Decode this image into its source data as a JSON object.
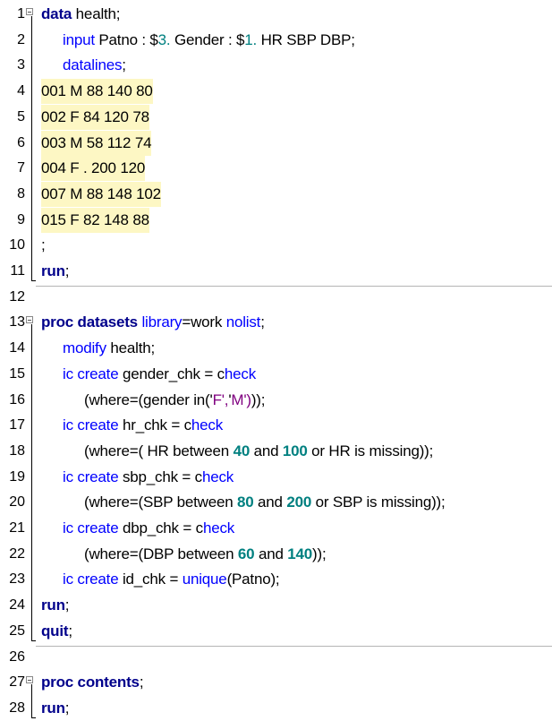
{
  "lines": [
    {
      "n": "1",
      "t": "data health;"
    },
    {
      "n": "2",
      "t": "input Patno : $3. Gender : $1. HR SBP DBP;"
    },
    {
      "n": "3",
      "t": "datalines;"
    },
    {
      "n": "4",
      "t": "001 M 88 140 80"
    },
    {
      "n": "5",
      "t": "002 F 84 120 78"
    },
    {
      "n": "6",
      "t": "003 M 58 112 74"
    },
    {
      "n": "7",
      "t": "004 F . 200 120"
    },
    {
      "n": "8",
      "t": "007 M 88 148 102"
    },
    {
      "n": "9",
      "t": "015 F 82 148 88"
    },
    {
      "n": "10",
      "t": ";"
    },
    {
      "n": "11",
      "t": "run;"
    },
    {
      "n": "12",
      "t": ""
    },
    {
      "n": "13",
      "t": "proc datasets library=work nolist;"
    },
    {
      "n": "14",
      "t": "modify health;"
    },
    {
      "n": "15",
      "t": "ic create gender_chk = check"
    },
    {
      "n": "16",
      "t": "(where=(gender in('F','M')));"
    },
    {
      "n": "17",
      "t": "ic create hr_chk = check"
    },
    {
      "n": "18",
      "t": "(where=( HR between 40 and 100 or HR is missing));"
    },
    {
      "n": "19",
      "t": "ic create sbp_chk = check"
    },
    {
      "n": "20",
      "t": "(where=(SBP between 80 and 200 or SBP is missing));"
    },
    {
      "n": "21",
      "t": "ic create dbp_chk = check"
    },
    {
      "n": "22",
      "t": "(where=(DBP between 60 and 140));"
    },
    {
      "n": "23",
      "t": "ic create id_chk = unique(Patno);"
    },
    {
      "n": "24",
      "t": "run;"
    },
    {
      "n": "25",
      "t": "quit;"
    },
    {
      "n": "26",
      "t": ""
    },
    {
      "n": "27",
      "t": "proc contents;"
    },
    {
      "n": "28",
      "t": "run;"
    }
  ],
  "syntax_colors": {
    "keyword": "#00008b",
    "statement": "#0000ff",
    "format": "#008080",
    "number": "#008080",
    "string": "#800080",
    "datalines_highlight": "#fdf7c4"
  }
}
